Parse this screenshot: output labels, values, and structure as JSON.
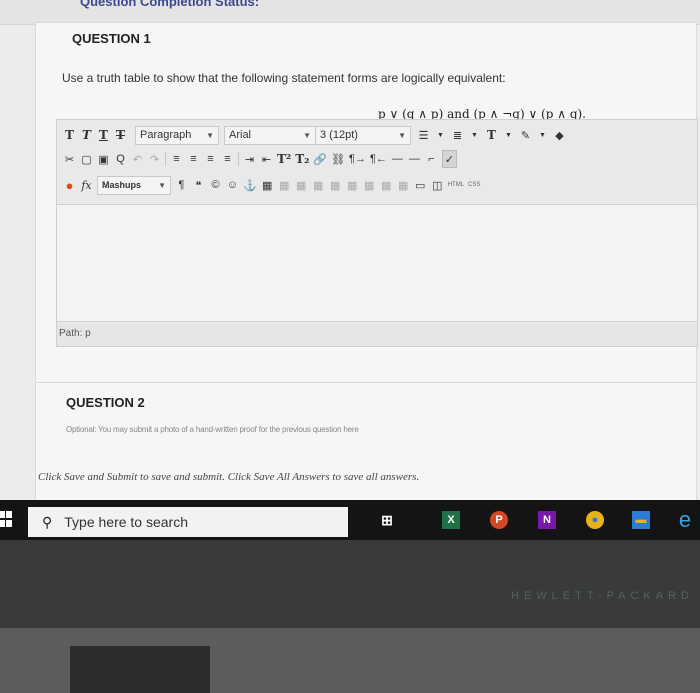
{
  "header": {
    "status_label": "Question Completion Status:"
  },
  "question1": {
    "title": "QUESTION 1",
    "prompt": "Use a truth table to show that the following statement forms are logically equivalent:",
    "formula": "p ∨ (q ∧ p) and (p ∧ ¬q) ∨ (p ∧ q)."
  },
  "editor": {
    "paragraph": "Paragraph",
    "font": "Arial",
    "size": "3 (12pt)",
    "mashups": "Mashups",
    "html": "HTML",
    "css": "CSS",
    "path_label": "Path: p"
  },
  "question2": {
    "title": "QUESTION 2",
    "prompt_cut": "Optional: You may submit a photo of a hand-written proof for the previous question here"
  },
  "footer": {
    "save_note": "Click Save and Submit to save and submit. Click Save All Answers to save all answers."
  },
  "taskbar": {
    "search_placeholder": "Type here to search"
  },
  "laptop": {
    "brand": "HEWLETT-PACKARD"
  }
}
